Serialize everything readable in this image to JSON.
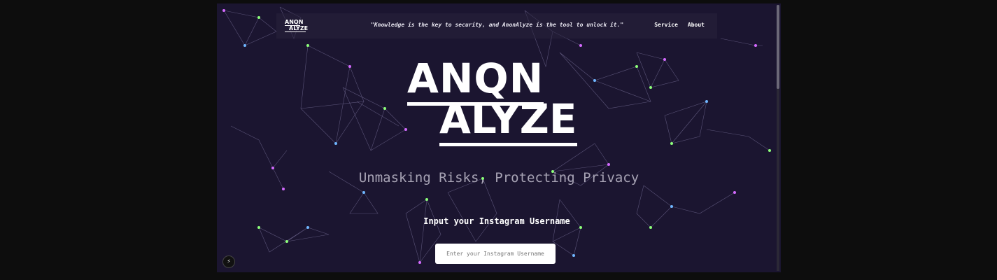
{
  "nav": {
    "logo_line1": "ANQN",
    "logo_line2": "ALYZE",
    "quote": "\"Knowledge is the key to security, and AnonAlyze is the tool to unlock it.\"",
    "links": [
      "Service",
      "About"
    ]
  },
  "hero": {
    "logo_line1": "ANQN",
    "logo_line2": "ALYZE",
    "tagline": "Unmasking Risks, Protecting Privacy",
    "input_label": "Input your Instagram Username",
    "input_placeholder": "Enter your Instagram Username",
    "input_value": ""
  },
  "colors": {
    "background": "#1b1530",
    "accent_pink": "#d46aff",
    "accent_green": "#8cff7a",
    "accent_blue": "#6fb6ff",
    "text": "#ffffff"
  },
  "dev_badge_icon": "lightning-icon"
}
